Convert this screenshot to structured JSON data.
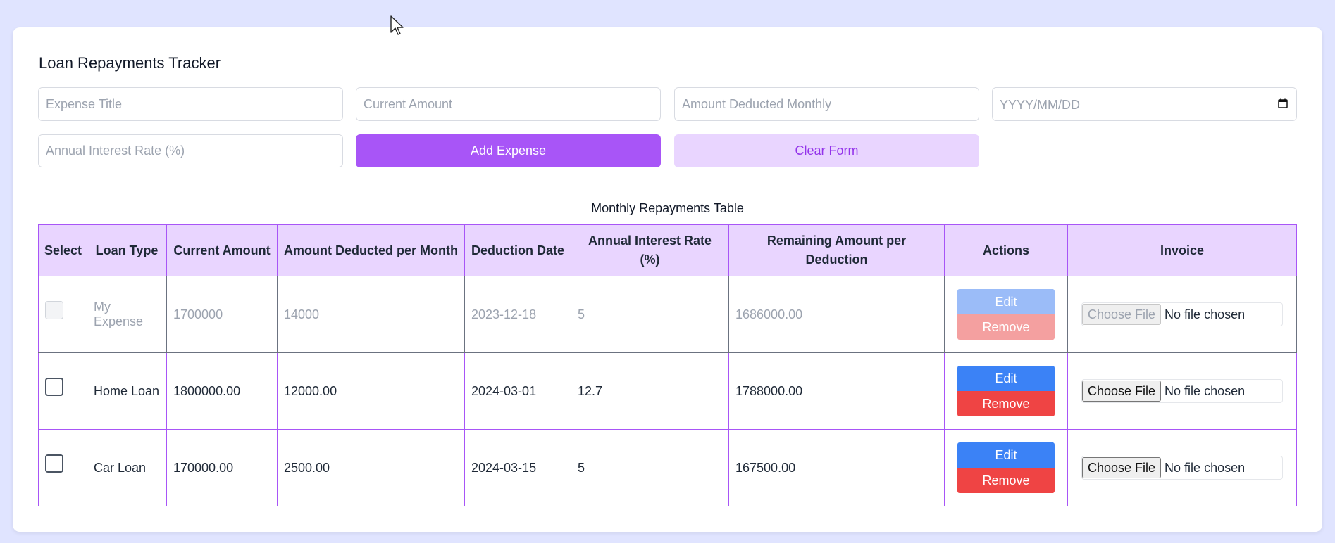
{
  "app": {
    "title": "Loan Repayments Tracker"
  },
  "form": {
    "expense_title_placeholder": "Expense Title",
    "current_amount_placeholder": "Current Amount",
    "amount_deducted_placeholder": "Amount Deducted Monthly",
    "date_placeholder": "YYYY/MM/DD",
    "interest_rate_placeholder": "Annual Interest Rate (%)",
    "add_button": "Add Expense",
    "clear_button": "Clear Form"
  },
  "table": {
    "caption": "Monthly Repayments Table",
    "headers": [
      "Select",
      "Loan Type",
      "Current Amount",
      "Amount Deducted per Month",
      "Deduction Date",
      "Annual Interest Rate (%)",
      "Remaining Amount per Deduction",
      "Actions",
      "Invoice"
    ],
    "rows": [
      {
        "loan_type": "My Expense",
        "current_amount": "1700000",
        "amount_deducted": "14000",
        "deduction_date": "2023-12-18",
        "interest_rate": "5",
        "remaining": "1686000.00",
        "disabled": true
      },
      {
        "loan_type": "Home Loan",
        "current_amount": "1800000.00",
        "amount_deducted": "12000.00",
        "deduction_date": "2024-03-01",
        "interest_rate": "12.7",
        "remaining": "1788000.00",
        "disabled": false
      },
      {
        "loan_type": "Car Loan",
        "current_amount": "170000.00",
        "amount_deducted": "2500.00",
        "deduction_date": "2024-03-15",
        "interest_rate": "5",
        "remaining": "167500.00",
        "disabled": false
      }
    ],
    "edit_label": "Edit",
    "remove_label": "Remove",
    "choose_file_label": "Choose File",
    "no_file_label": "No file chosen"
  },
  "colors": {
    "page_bg": "#e0e4ff",
    "accent": "#a855f7",
    "accent_light": "#e9d5ff",
    "edit": "#3b82f6",
    "remove": "#ef4444"
  }
}
